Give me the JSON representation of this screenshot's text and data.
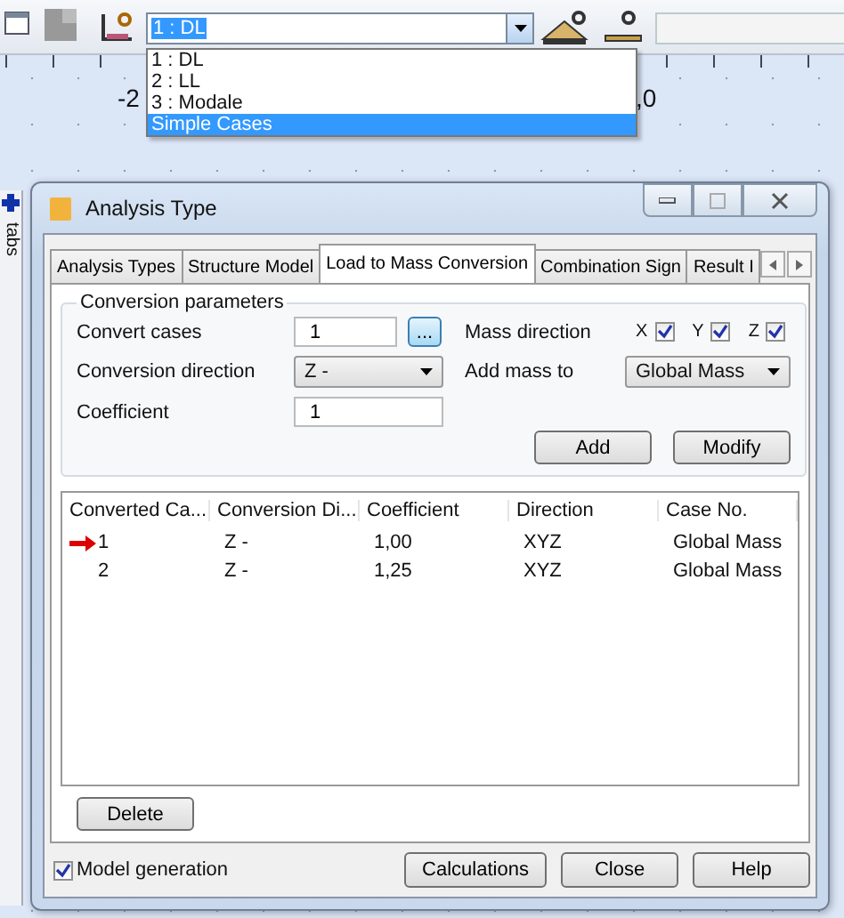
{
  "toolbar": {
    "case_combo": {
      "value": "1 : DL"
    },
    "case_list": [
      {
        "label": "1 : DL",
        "selected": false
      },
      {
        "label": "2 : LL",
        "selected": false
      },
      {
        "label": "3 : Modale",
        "selected": false
      },
      {
        "label": "Simple Cases",
        "selected": true
      }
    ]
  },
  "ruler_labels": [
    "-2",
    ",0"
  ],
  "side_tab": "tabs",
  "dialog": {
    "title": "Analysis Type",
    "tabs": [
      {
        "label": "Analysis Types",
        "selected": false
      },
      {
        "label": "Structure Model",
        "selected": false
      },
      {
        "label": "Load to Mass Conversion",
        "selected": true
      },
      {
        "label": "Combination Sign",
        "selected": false
      },
      {
        "label": "Result I",
        "selected": false
      }
    ],
    "group_title": "Conversion parameters",
    "convert_cases": {
      "label": "Convert cases",
      "value": "1",
      "browse": "..."
    },
    "mass_direction": {
      "label": "Mass direction",
      "axes": [
        {
          "label": "X",
          "checked": true
        },
        {
          "label": "Y",
          "checked": true
        },
        {
          "label": "Z",
          "checked": true
        }
      ]
    },
    "conversion_direction": {
      "label": "Conversion direction",
      "value": "Z -"
    },
    "add_mass_to": {
      "label": "Add mass to",
      "value": "Global Mass"
    },
    "coefficient": {
      "label": "Coefficient",
      "value": "1"
    },
    "buttons": [
      "Add",
      "Modify"
    ],
    "table": {
      "columns": [
        "Converted Ca...",
        "Conversion Di...",
        "Coefficient",
        "Direction",
        "Case No."
      ],
      "rows": [
        {
          "current": true,
          "cells": [
            "1",
            "Z -",
            "1,00",
            "XYZ",
            "Global Mass"
          ]
        },
        {
          "current": false,
          "cells": [
            "2",
            "Z -",
            "1,25",
            "XYZ",
            "Global Mass"
          ]
        }
      ]
    },
    "delete_button": "Delete",
    "model_generation": {
      "label": "Model generation",
      "checked": true
    },
    "footer_buttons": [
      "Calculations",
      "Close",
      "Help"
    ]
  }
}
